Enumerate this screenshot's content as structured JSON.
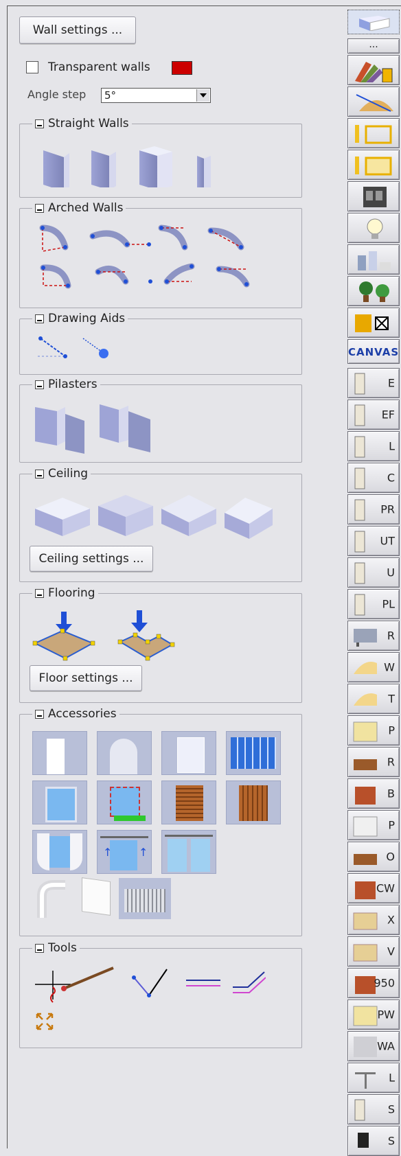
{
  "buttons": {
    "wall_settings": "Wall settings ...",
    "ceiling_settings": "Ceiling settings ...",
    "floor_settings": "Floor settings ..."
  },
  "transparent": {
    "label": "Transparent walls",
    "checked": false,
    "color": "#cc0000"
  },
  "angle_step": {
    "label": "Angle step",
    "value": "5°"
  },
  "groups": {
    "straight": "Straight Walls",
    "arched": "Arched Walls",
    "drawing": "Drawing Aids",
    "pilasters": "Pilasters",
    "ceiling": "Ceiling",
    "flooring": "Flooring",
    "accessories": "Accessories",
    "tools": "Tools"
  },
  "sidebar": {
    "more": "...",
    "canvas": "CANVAS",
    "labels": [
      "E",
      "EF",
      "L",
      "C",
      "PR",
      "UT",
      "U",
      "PL",
      "R",
      "W",
      "T",
      "P",
      "R",
      "B",
      "P",
      "O",
      "CW",
      "X",
      "V",
      "950",
      "PW",
      "WA",
      "L",
      "S",
      "S"
    ]
  },
  "colors": {
    "accent": "#cc0000",
    "tile": "#b8bfd8",
    "wall": "#8d94c4",
    "blue": "#1f4fd6"
  }
}
